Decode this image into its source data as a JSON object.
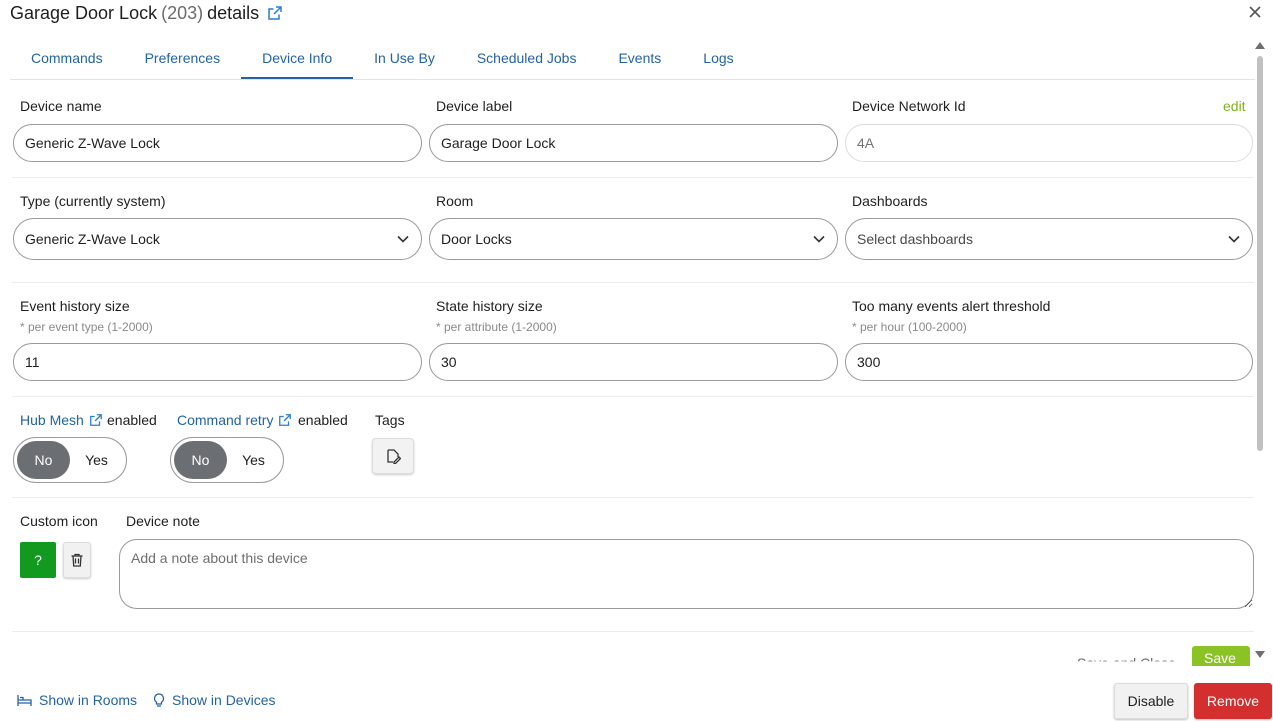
{
  "header": {
    "device_title": "Garage Door Lock",
    "device_id": "(203)",
    "title_suffix": "details"
  },
  "tabs": [
    {
      "label": "Commands"
    },
    {
      "label": "Preferences"
    },
    {
      "label": "Device Info",
      "active": true
    },
    {
      "label": "In Use By"
    },
    {
      "label": "Scheduled Jobs"
    },
    {
      "label": "Events"
    },
    {
      "label": "Logs"
    }
  ],
  "device_name": {
    "label": "Device name",
    "value": "Generic Z-Wave Lock"
  },
  "device_label": {
    "label": "Device label",
    "value": "Garage Door Lock"
  },
  "network_id": {
    "label": "Device Network Id",
    "placeholder": "4A",
    "edit_label": "edit"
  },
  "type": {
    "label": "Type (currently system)",
    "value": "Generic Z-Wave Lock"
  },
  "room": {
    "label": "Room",
    "value": "Door Locks"
  },
  "dashboards": {
    "label": "Dashboards",
    "placeholder": "Select dashboards"
  },
  "event_history": {
    "label": "Event history size",
    "hint": "* per event type (1-2000)",
    "value": "11"
  },
  "state_history": {
    "label": "State history size",
    "hint": "* per attribute (1-2000)",
    "value": "30"
  },
  "alert_threshold": {
    "label": "Too many events alert threshold",
    "hint": "* per hour (100-2000)",
    "value": "300"
  },
  "hub_mesh": {
    "link": "Hub Mesh",
    "suffix": "enabled",
    "no": "No",
    "yes": "Yes",
    "selected": "No"
  },
  "command_retry": {
    "link": "Command retry",
    "suffix": "enabled",
    "no": "No",
    "yes": "Yes",
    "selected": "No"
  },
  "tags": {
    "label": "Tags"
  },
  "custom_icon": {
    "label": "Custom icon",
    "swatch_text": "?"
  },
  "device_note": {
    "label": "Device note",
    "placeholder": "Add a note about this device"
  },
  "actions_peek": {
    "save_close": "Save and Close",
    "save": "Save"
  },
  "footer": {
    "show_rooms": "Show in Rooms",
    "show_devices": "Show in Devices",
    "disable": "Disable",
    "remove": "Remove"
  },
  "colors": {
    "link": "#2463a3",
    "accent_green": "#80b31a",
    "remove_red": "#d32f2f",
    "icon_green": "#119a1f"
  }
}
